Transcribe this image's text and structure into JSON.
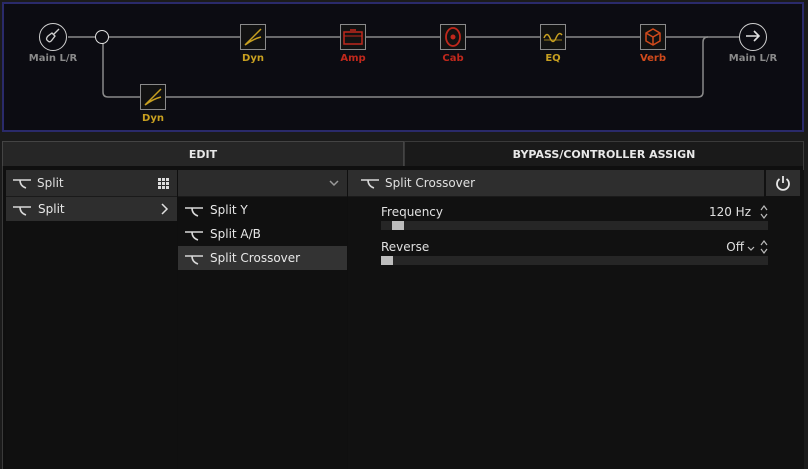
{
  "chain": {
    "input_label": "Main L/R",
    "output_label": "Main L/R",
    "blocks": [
      {
        "label": "Dyn",
        "color": "#c8a020",
        "icon": "dynamics-icon"
      },
      {
        "label": "Amp",
        "color": "#c0281c",
        "icon": "amp-icon"
      },
      {
        "label": "Cab",
        "color": "#c0281c",
        "icon": "cab-icon"
      },
      {
        "label": "EQ",
        "color": "#c8a020",
        "icon": "eq-icon"
      },
      {
        "label": "Verb",
        "color": "#d04a1c",
        "icon": "reverb-icon"
      }
    ],
    "lower_blocks": [
      {
        "label": "Dyn",
        "color": "#c8a020",
        "icon": "dynamics-icon"
      }
    ]
  },
  "tabs": {
    "edit": "EDIT",
    "bypass": "BYPASS/CONTROLLER ASSIGN"
  },
  "category": {
    "header": "Split",
    "items": [
      {
        "label": "Split"
      }
    ]
  },
  "models": {
    "items": [
      {
        "label": "Split Y"
      },
      {
        "label": "Split A/B"
      },
      {
        "label": "Split Crossover"
      }
    ],
    "selected": "Split Crossover"
  },
  "editor": {
    "title": "Split Crossover",
    "params": [
      {
        "label": "Frequency",
        "value": "120 Hz",
        "level": 0.03
      },
      {
        "label": "Reverse",
        "value": "Off",
        "level": 0.0
      }
    ]
  }
}
